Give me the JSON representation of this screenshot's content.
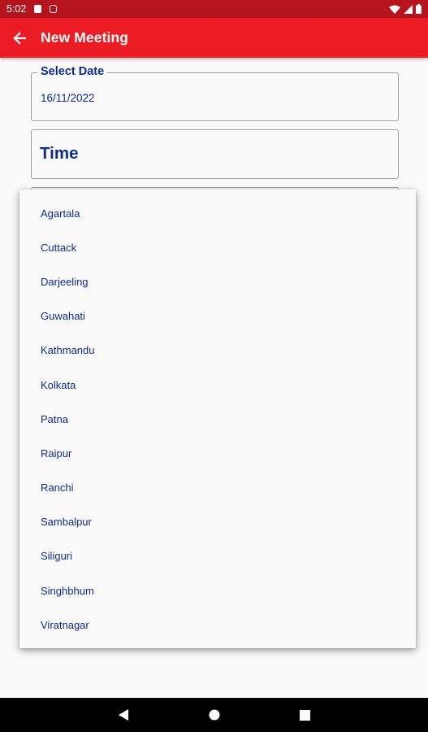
{
  "status_bar": {
    "time": "5:02",
    "icons": [
      "notification-icon",
      "sim-icon",
      "wifi-icon",
      "signal-icon",
      "battery-icon"
    ]
  },
  "app_bar": {
    "title": "New Meeting",
    "back_icon": "arrow-left-icon"
  },
  "form": {
    "date_field": {
      "legend": "Select Date",
      "value": "16/11/2022"
    },
    "time_field": {
      "label": "Time"
    }
  },
  "dropdown": {
    "items": [
      "Agartala",
      "Cuttack",
      "Darjeeling",
      "Guwahati",
      "Kathmandu",
      "Kolkata",
      "Patna",
      "Raipur",
      "Ranchi",
      "Sambalpur",
      "Siliguri",
      "Singhbhum",
      "Viratnagar"
    ]
  },
  "nav_bar": {
    "buttons": [
      "back-icon",
      "home-icon",
      "recents-icon"
    ]
  },
  "colors": {
    "status_bar": "#b5141f",
    "app_bar": "#ec1c24",
    "text_primary": "#0d2c8c",
    "background": "#fafafa"
  }
}
